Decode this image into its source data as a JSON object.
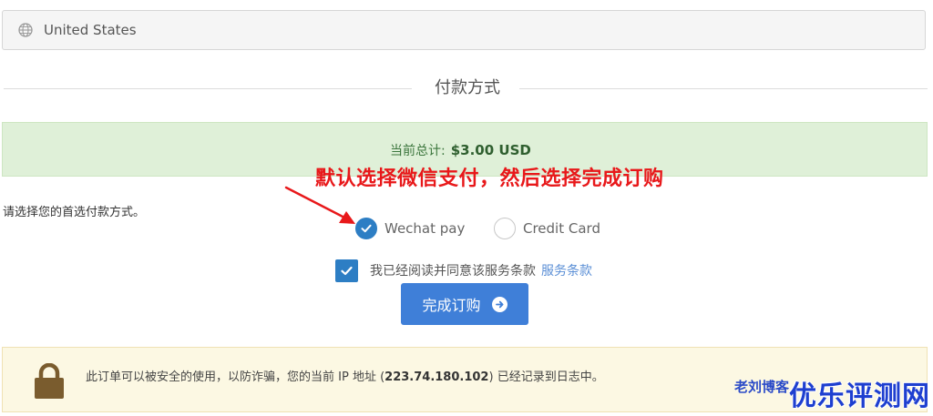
{
  "country": {
    "value": "United States",
    "icon": "globe-icon"
  },
  "payment_section": {
    "title": "付款方式"
  },
  "total": {
    "label": "当前总计:",
    "amount": "$3.00 USD"
  },
  "annotation": {
    "text": "默认选择微信支付，然后选择完成订购"
  },
  "payment_prompt": "请选择您的首选付款方式。",
  "payment_methods": [
    {
      "label": "Wechat pay",
      "selected": true
    },
    {
      "label": "Credit Card",
      "selected": false
    }
  ],
  "terms": {
    "text": "我已经阅读并同意该服务条款",
    "link": "服务条款",
    "checked": true
  },
  "complete_button": {
    "label": "完成订购",
    "icon": "arrow-right-circle-icon"
  },
  "security_notice": {
    "prefix": "此订单可以被安全的使用，以防诈骗，您的当前 IP 地址 (",
    "ip": "223.74.180.102",
    "suffix": ") 已经记录到日志中。",
    "icon": "lock-icon"
  },
  "watermark": {
    "small": "老刘博客",
    "large": "优乐评测网"
  },
  "colors": {
    "primary": "#3f7fd8",
    "success_bg": "#dff0d8",
    "warning_bg": "#fcf8e3",
    "annotation": "#e8181a",
    "link": "#5b8fd6"
  }
}
